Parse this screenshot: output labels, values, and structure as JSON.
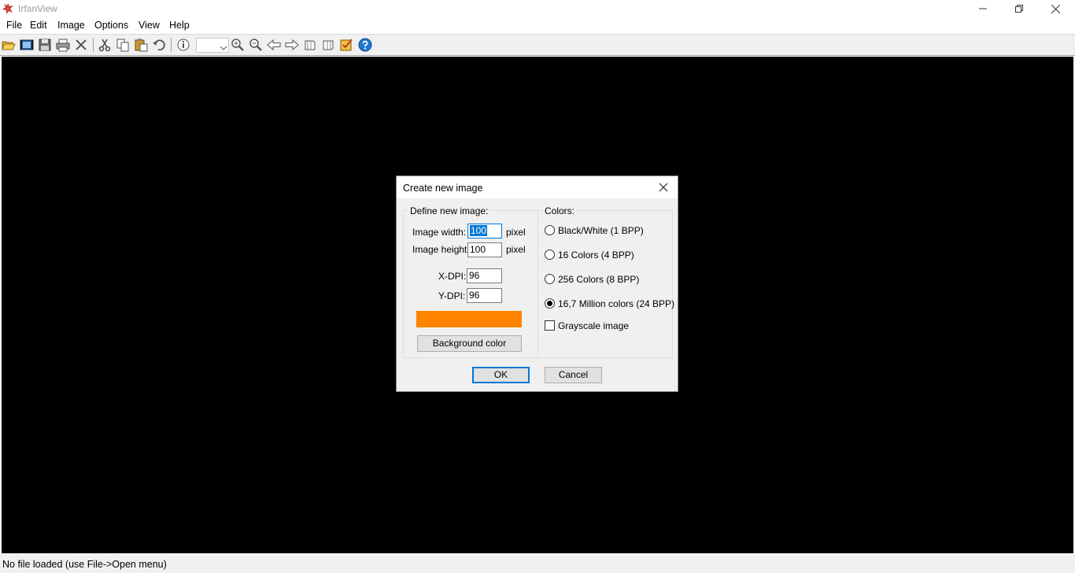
{
  "app": {
    "title": "IrfanView"
  },
  "menu": {
    "items": [
      "File",
      "Edit",
      "Image",
      "Options",
      "View",
      "Help"
    ]
  },
  "toolbar": {
    "icons": [
      "open-folder-icon",
      "slideshow-icon",
      "save-icon",
      "print-icon",
      "delete-icon",
      "cut-icon",
      "copy-icon",
      "paste-icon",
      "undo-icon",
      "info-icon",
      "zoom-in-icon",
      "zoom-out-icon",
      "previous-icon",
      "next-icon",
      "rotate-left-icon",
      "rotate-right-icon",
      "settings-icon",
      "help-icon"
    ],
    "zoom_value": ""
  },
  "status": {
    "text": "No file loaded (use File->Open menu)"
  },
  "dialog": {
    "title": "Create new image",
    "define_group_label": "Define new image:",
    "width_label": "Image width:",
    "width_value": "100",
    "height_label": "Image height:",
    "height_value": "100",
    "unit": "pixel",
    "xdpi_label": "X-DPI:",
    "xdpi_value": "96",
    "ydpi_label": "Y-DPI:",
    "ydpi_value": "96",
    "background_color": "#ff8400",
    "background_button": "Background color",
    "colors_group_label": "Colors:",
    "color_options": [
      {
        "label": "Black/White (1 BPP)",
        "selected": false
      },
      {
        "label": "16 Colors (4 BPP)",
        "selected": false
      },
      {
        "label": "256 Colors (8 BPP)",
        "selected": false
      },
      {
        "label": "16,7 Million colors (24 BPP)",
        "selected": true
      }
    ],
    "grayscale_label": "Grayscale image",
    "grayscale_checked": false,
    "ok_label": "OK",
    "cancel_label": "Cancel"
  },
  "colors": {
    "canvas": "#000000",
    "accent": "#0078d7"
  }
}
